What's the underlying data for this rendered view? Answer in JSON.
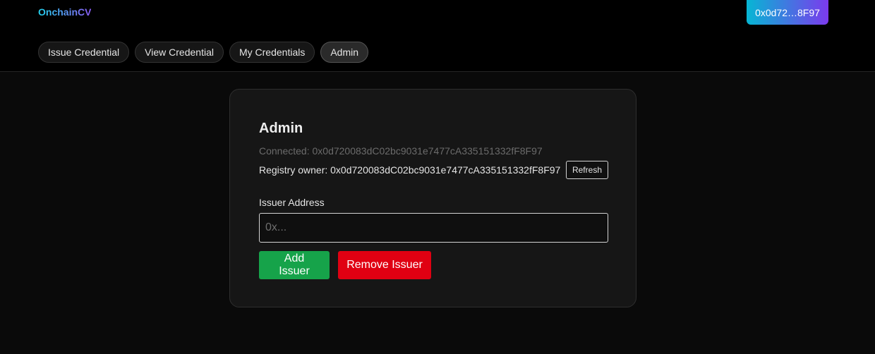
{
  "header": {
    "brand": "OnchainCV",
    "wallet_label": "0x0d72…8F97",
    "tabs": [
      {
        "label": "Issue Credential",
        "active": false
      },
      {
        "label": "View Credential",
        "active": false
      },
      {
        "label": "My Credentials",
        "active": false
      },
      {
        "label": "Admin",
        "active": true
      }
    ]
  },
  "admin": {
    "title": "Admin",
    "connected": "Connected: 0x0d720083dC02bc9031e7477cA335151332fF8F97",
    "registry_owner": "Registry owner: 0x0d720083dC02bc9031e7477cA335151332fF8F97",
    "refresh_label": "Refresh",
    "issuer_label": "Issuer Address",
    "issuer_placeholder": "0x...",
    "issuer_value": "",
    "add_label": "Add Issuer",
    "remove_label": "Remove Issuer"
  },
  "colors": {
    "add_button": "#16a34a",
    "remove_button": "#e00012",
    "brand_gradient_start": "#22d3ee",
    "brand_gradient_end": "#8b5cf6"
  }
}
